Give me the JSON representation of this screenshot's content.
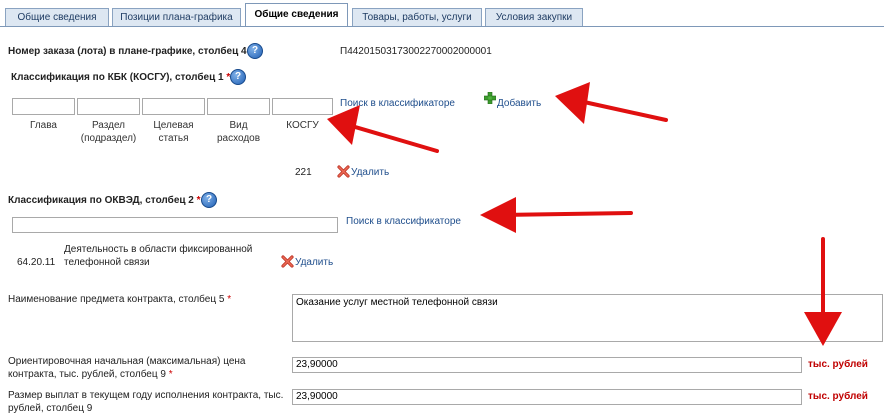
{
  "tabs": [
    {
      "label": "Общие сведения"
    },
    {
      "label": "Позиции плана-графика"
    },
    {
      "label": "Общие сведения"
    },
    {
      "label": "Товары, работы, услуги"
    },
    {
      "label": "Условия закупки"
    }
  ],
  "order": {
    "label": "Номер заказа (лота) в плане-графике, столбец 4",
    "value": "П44201503173002270002000001"
  },
  "kbk": {
    "label": "Классификация по КБК (КОСГУ), столбец 1",
    "search_link": "Поиск в классификаторе",
    "add_label": "Добавить",
    "columns": [
      "Глава",
      "Раздел (подраздел)",
      "Целевая статья",
      "Вид расходов",
      "КОСГУ"
    ],
    "entry_value": "221",
    "delete_label": "Удалить"
  },
  "okved": {
    "label": "Классификация по ОКВЭД, столбец 2",
    "search_link": "Поиск в классификаторе",
    "code": "64.20.11",
    "description": "Деятельность в области фиксированной телефонной связи",
    "delete_label": "Удалить"
  },
  "subject": {
    "label": "Наименование предмета контракта, столбец 5",
    "value": "Оказание услуг местной телефонной связи"
  },
  "price": {
    "label": "Ориентировочная начальная (максимальная) цена контракта, тыс. рублей, столбец 9",
    "value": "23,90000",
    "unit": "тыс. рублей"
  },
  "payment": {
    "label": "Размер выплат в текущем году исполнения контракта, тыс. рублей, столбец 9",
    "value": "23,90000",
    "unit": "тыс. рублей"
  },
  "common": {
    "required_mark": "*",
    "help_glyph": "?"
  },
  "colors": {
    "accent_link": "#1f4e8c",
    "arrow": "#e01010",
    "required": "#cc0000",
    "tab_bg": "#dde7f2"
  }
}
